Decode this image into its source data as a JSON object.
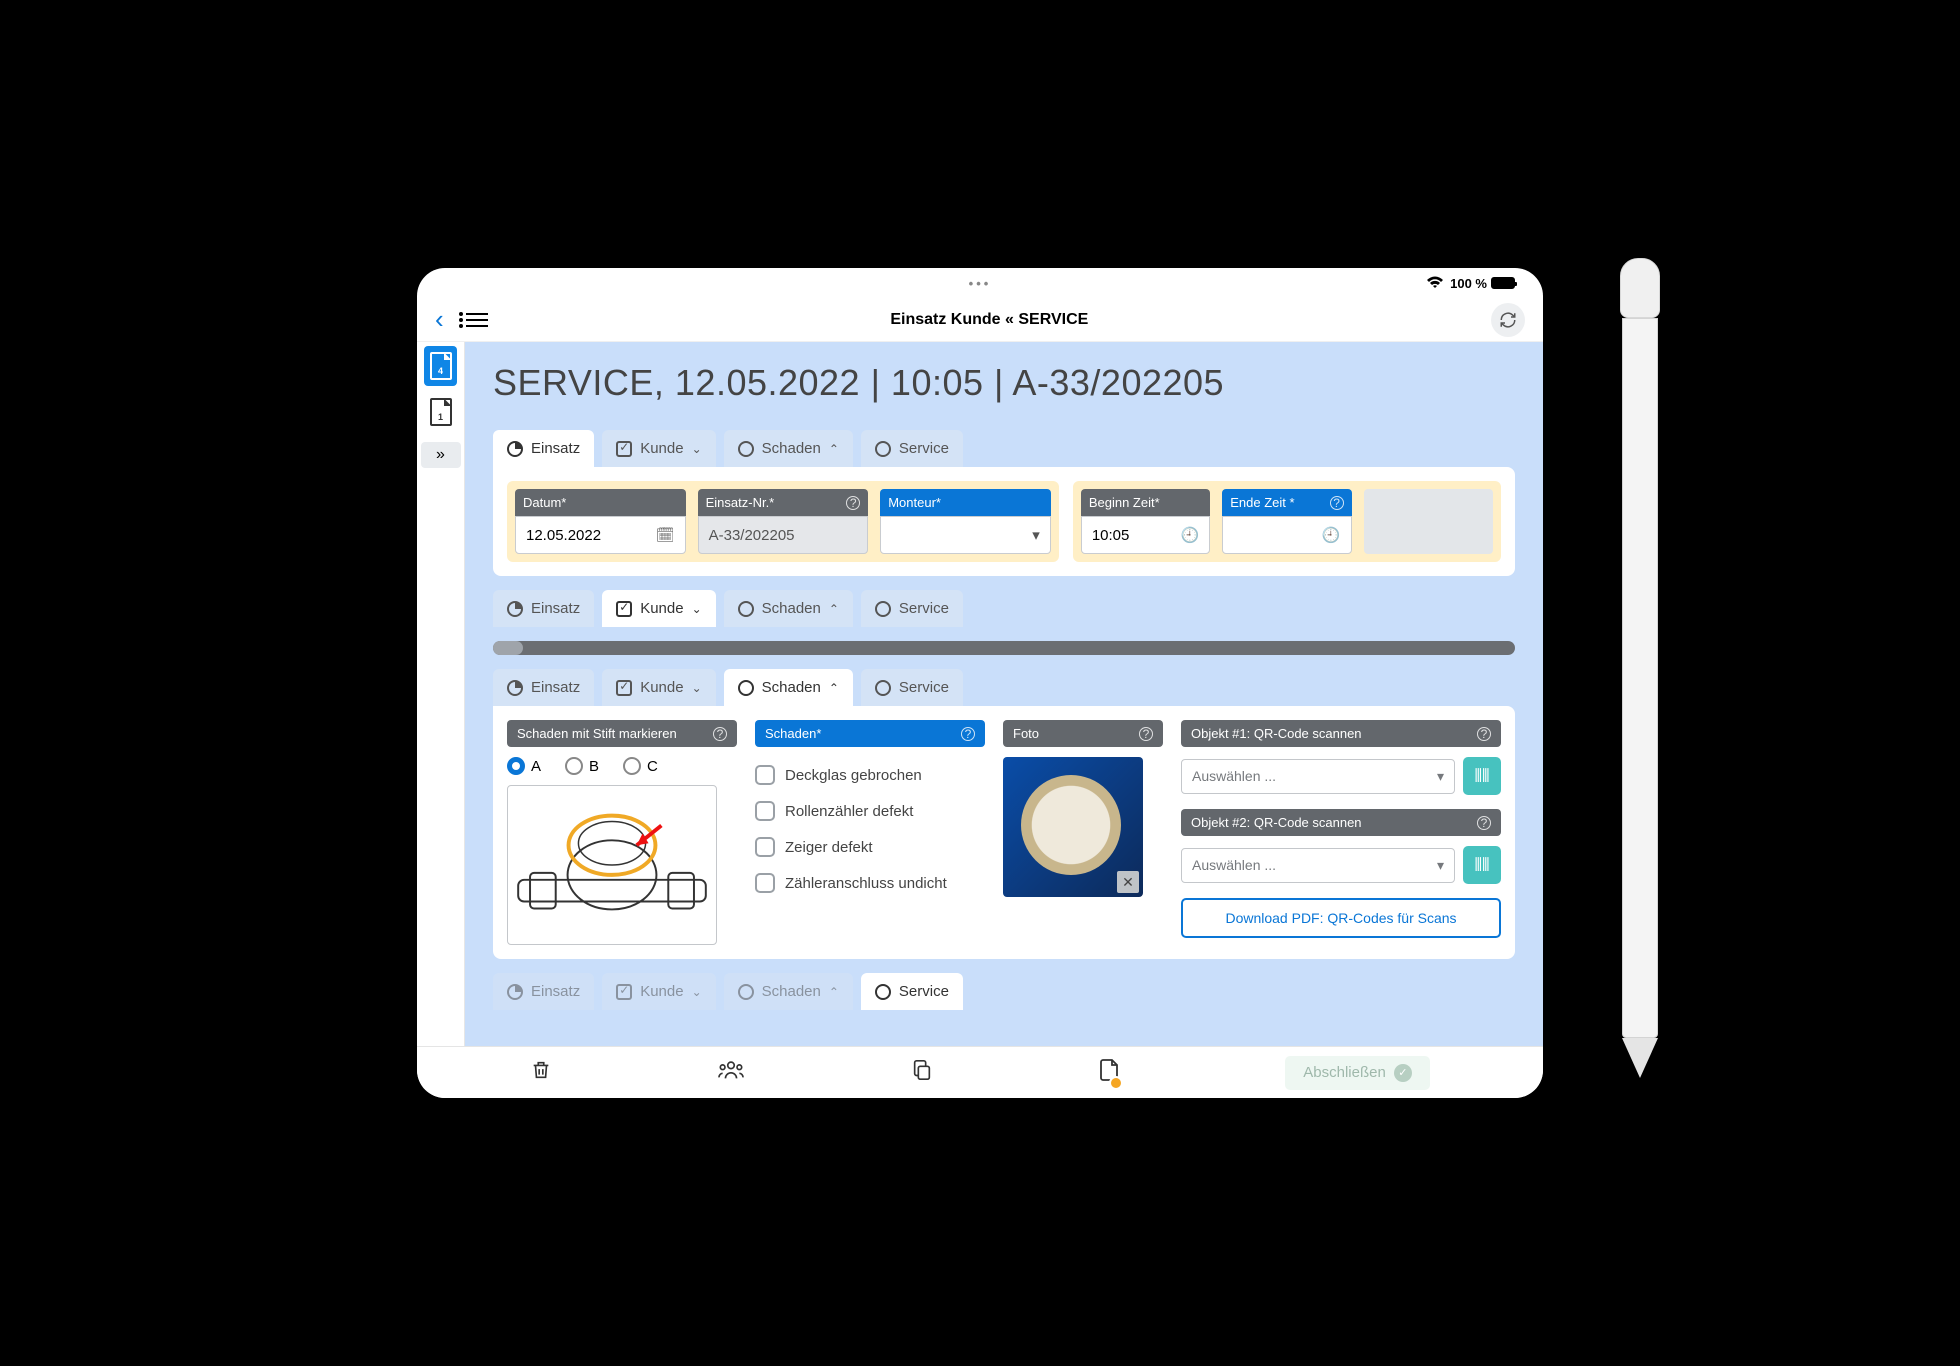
{
  "status": {
    "battery": "100 %"
  },
  "nav": {
    "title": "Einsatz Kunde « SERVICE"
  },
  "sidebar": {
    "doc1": "4",
    "doc2": "1",
    "expand": "»"
  },
  "header": {
    "title": "SERVICE,  12.05.2022 | 10:05 | A-33/202205"
  },
  "tabs": {
    "einsatz": "Einsatz",
    "kunde": "Kunde",
    "schaden": "Schaden",
    "service": "Service"
  },
  "einsatz": {
    "datum_label": "Datum*",
    "datum_value": "12.05.2022",
    "nr_label": "Einsatz-Nr.*",
    "nr_value": "A-33/202205",
    "monteur_label": "Monteur*",
    "beginn_label": "Beginn Zeit*",
    "beginn_value": "10:05",
    "ende_label": "Ende Zeit *"
  },
  "schaden": {
    "mark_label": "Schaden mit Stift markieren",
    "opt_a": "A",
    "opt_b": "B",
    "opt_c": "C",
    "list_label": "Schaden*",
    "i1": "Deckglas gebrochen",
    "i2": "Rollenzähler defekt",
    "i3": "Zeiger defekt",
    "i4": "Zähleranschluss undicht",
    "foto_label": "Foto",
    "qr1_label": "Objekt #1: QR-Code scannen",
    "qr2_label": "Objekt #2: QR-Code scannen",
    "select_placeholder": "Auswählen ...",
    "download": "Download PDF: QR-Codes für Scans"
  },
  "toolbar": {
    "finish": "Abschließen"
  }
}
